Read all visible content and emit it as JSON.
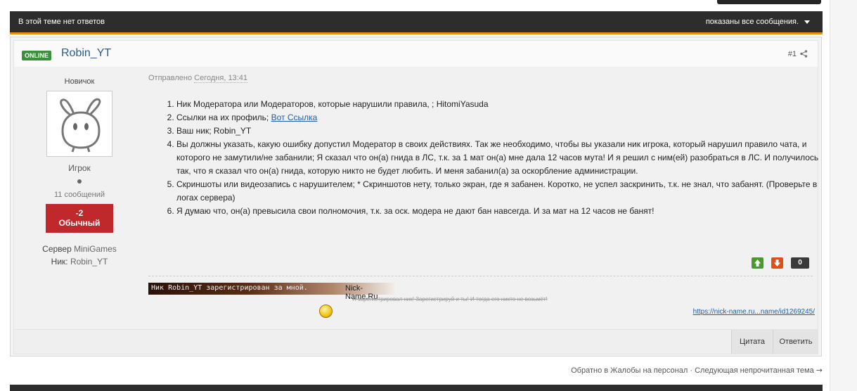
{
  "thread_bar": {
    "status": "В этой теме нет ответов",
    "filter": "показаны все сообщения."
  },
  "post": {
    "online_badge": "ONLINE",
    "author": "Robin_YT",
    "number": "#1",
    "rank_title": "Новичок",
    "group": "Игрок",
    "post_count": "11 сообщений",
    "reputation": {
      "value": "-2",
      "label": "Обычный"
    },
    "fields": [
      {
        "label": "Сервер",
        "value": "MiniGames"
      },
      {
        "label": "Ник:",
        "value": "Robin_YT"
      }
    ],
    "posted_label": "Отправлено",
    "posted_date": "Сегодня, 13:41",
    "items": [
      {
        "text": "Ник Модератора или Модераторов, которые нарушили правила, ; HitomiYasuda"
      },
      {
        "text": "Ссылки на их профиль; ",
        "link": "Вот Ссылка"
      },
      {
        "text": "Ваш ник; Robin_YT"
      },
      {
        "text": "Вы должны указать, какую ошибку допустил Модератор в своих действиях. Так же необходимо, чтобы вы указали ник игрока, который нарушил правило чата, и которого не замутили/не забанили; Я сказал что он(а) гнида в ЛС, т.к. за 1 мат он(а) мне дала 12 часов мута! И я решил с ним(ей) разобраться в ЛС. И получилось так, что я сказал что он(а) гнида, которую никто не будет любить. И меня забанил(а) за оскорбление администрации."
      },
      {
        "text": "Скриншоты или видеозапись с нарушителем; * Скриншотов нету, только экран, где я забанен. Коротко, не успел заскринить, т.к. не знал, что забанят. (Проверьте в логах сервера)"
      },
      {
        "text": "Я думаю что, он(а) превысила свои полномочия, т.к. за оск. модера не дают бан навсегда. И за мат на 12 часов не банят!"
      }
    ],
    "vote_count": "0",
    "signature": {
      "banner_text": "Ник Robin_YT зарегистрирован за мной.",
      "banner_site": "Nick-Name.Ru",
      "note": "Я зарегистрировал ник! Зарегистрируй и ты! И тогда его никто не возьмёт!",
      "link": "https://nick-name.ru...name/id1269245/"
    },
    "buttons": {
      "quote": "Цитата",
      "reply": "Ответить"
    }
  },
  "nav": {
    "back": "Обратно в Жалобы на персонал",
    "separator": "·",
    "next": "Следующая непрочитанная тема",
    "next_arrow": "→"
  },
  "colors": {
    "bar_bg": "#2d2d2d",
    "bar_accent": "#e8910f",
    "online": "#3c8f3c",
    "reputation_negative": "#c0292b",
    "link": "#1f5fa3"
  }
}
